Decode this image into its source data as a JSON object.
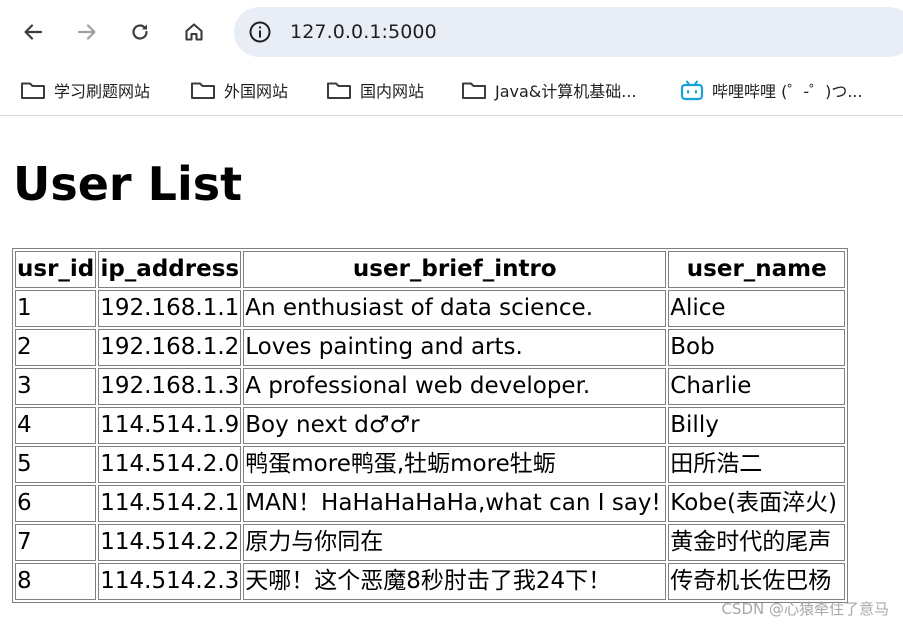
{
  "browser": {
    "url": "127.0.0.1:5000",
    "bookmarks": [
      {
        "label": "学习刷题网站",
        "icon": "folder-icon"
      },
      {
        "label": "外国网站",
        "icon": "folder-icon"
      },
      {
        "label": "国内网站",
        "icon": "folder-icon"
      },
      {
        "label": "Java&计算机基础...",
        "icon": "folder-icon"
      },
      {
        "label": "哔哩哔哩 (゜-゜)つ...",
        "icon": "bilibili-icon"
      }
    ]
  },
  "page": {
    "title": "User List",
    "table": {
      "headers": [
        "usr_id",
        "ip_address",
        "user_brief_intro",
        "user_name"
      ],
      "rows": [
        [
          "1",
          "192.168.1.1",
          "An enthusiast of data science.",
          "Alice"
        ],
        [
          "2",
          "192.168.1.2",
          "Loves painting and arts.",
          "Bob"
        ],
        [
          "3",
          "192.168.1.3",
          "A professional web developer.",
          "Charlie"
        ],
        [
          "4",
          "114.514.1.9",
          "Boy next d♂♂r",
          "Billy"
        ],
        [
          "5",
          "114.514.2.0",
          "鸭蛋more鸭蛋,牡蛎more牡蛎",
          "田所浩二"
        ],
        [
          "6",
          "114.514.2.1",
          "MAN！HaHaHaHaHa,what can I say!",
          "Kobe(表面淬火)"
        ],
        [
          "7",
          "114.514.2.2",
          "原力与你同在",
          "黄金时代的尾声"
        ],
        [
          "8",
          "114.514.2.3",
          "天哪！这个恶魔8秒肘击了我24下！",
          "传奇机长佐巴杨"
        ]
      ]
    }
  },
  "watermark": "CSDN @心猿牵住了意马"
}
